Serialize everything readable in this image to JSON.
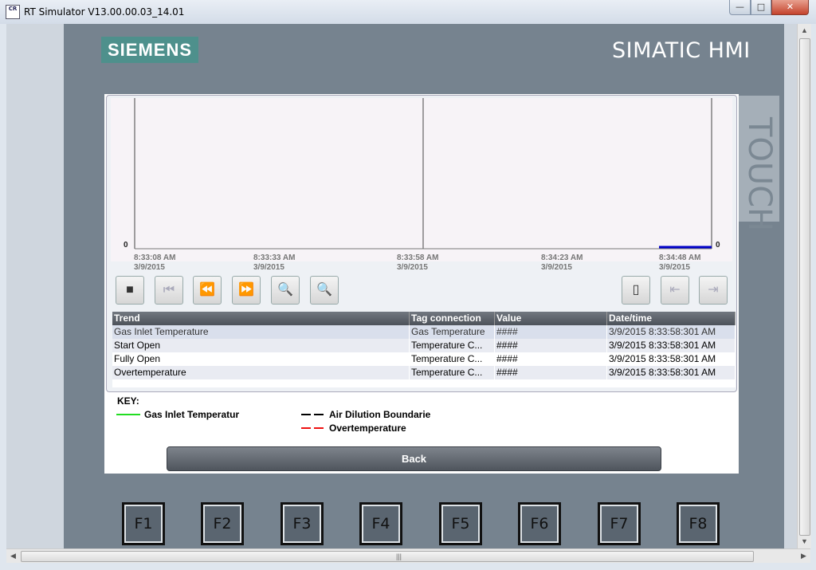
{
  "window": {
    "title": "RT Simulator V13.00.00.03_14.01",
    "icon_text": "CR",
    "min_glyph": "—",
    "max_glyph": "□",
    "close_glyph": "✕"
  },
  "hmi": {
    "brand": "SIEMENS",
    "product": "SIMATIC HMI",
    "touch": "TOUCH"
  },
  "trend": {
    "y_left": "0",
    "y_right": "0",
    "x_ticks": [
      {
        "time": "8:33:08 AM",
        "date": "3/9/2015"
      },
      {
        "time": "8:33:33 AM",
        "date": "3/9/2015"
      },
      {
        "time": "8:33:58 AM",
        "date": "3/9/2015"
      },
      {
        "time": "8:34:23 AM",
        "date": "3/9/2015"
      },
      {
        "time": "8:34:48 AM",
        "date": "3/9/2015"
      }
    ],
    "toolbar": [
      {
        "name": "stop-button",
        "icon": "stop-icon",
        "glyph": "■",
        "enabled": true
      },
      {
        "name": "first-button",
        "icon": "skip-back-icon",
        "glyph": "⏮",
        "enabled": false
      },
      {
        "name": "rewind-button",
        "icon": "rewind-icon",
        "glyph": "⏪",
        "enabled": false
      },
      {
        "name": "forward-button",
        "icon": "fast-forward-icon",
        "glyph": "⏩",
        "enabled": true
      },
      {
        "name": "zoom-in-button",
        "icon": "zoom-in-icon",
        "glyph": "🔍",
        "enabled": true
      },
      {
        "name": "zoom-out-button",
        "icon": "zoom-out-icon",
        "glyph": "🔍",
        "enabled": true
      },
      {
        "name": "ruler-button",
        "icon": "ruler-icon",
        "glyph": "▯",
        "enabled": true
      },
      {
        "name": "ruler-left-button",
        "icon": "ruler-left-icon",
        "glyph": "⇤",
        "enabled": false
      },
      {
        "name": "ruler-right-button",
        "icon": "ruler-right-icon",
        "glyph": "⇥",
        "enabled": false
      }
    ],
    "line_color": "#0000c8"
  },
  "table": {
    "headers": [
      "Trend",
      "Tag connection",
      "Value",
      "Date/time"
    ],
    "rows": [
      [
        "Gas Inlet Temperature",
        "Gas Temperature",
        "####",
        "3/9/2015 8:33:58:301 AM"
      ],
      [
        "Start Open",
        "Temperature C...",
        "####",
        "3/9/2015 8:33:58:301 AM"
      ],
      [
        "Fully Open",
        "Temperature C...",
        "####",
        "3/9/2015 8:33:58:301 AM"
      ],
      [
        "Overtemperature",
        "Temperature C...",
        "####",
        "3/9/2015 8:33:58:301 AM"
      ]
    ]
  },
  "key": {
    "title": "KEY:",
    "items": [
      {
        "label": "Gas Inlet Temperatur",
        "color": "#22dd22",
        "style": "solid"
      },
      {
        "label": "Air Dilution Boundarie",
        "color": "#000000",
        "style": "dashed"
      },
      {
        "label": "Overtemperature",
        "color": "#ee1111",
        "style": "dashed"
      }
    ]
  },
  "back_label": "Back",
  "function_keys": [
    "F1",
    "F2",
    "F3",
    "F4",
    "F5",
    "F6",
    "F7",
    "F8"
  ]
}
